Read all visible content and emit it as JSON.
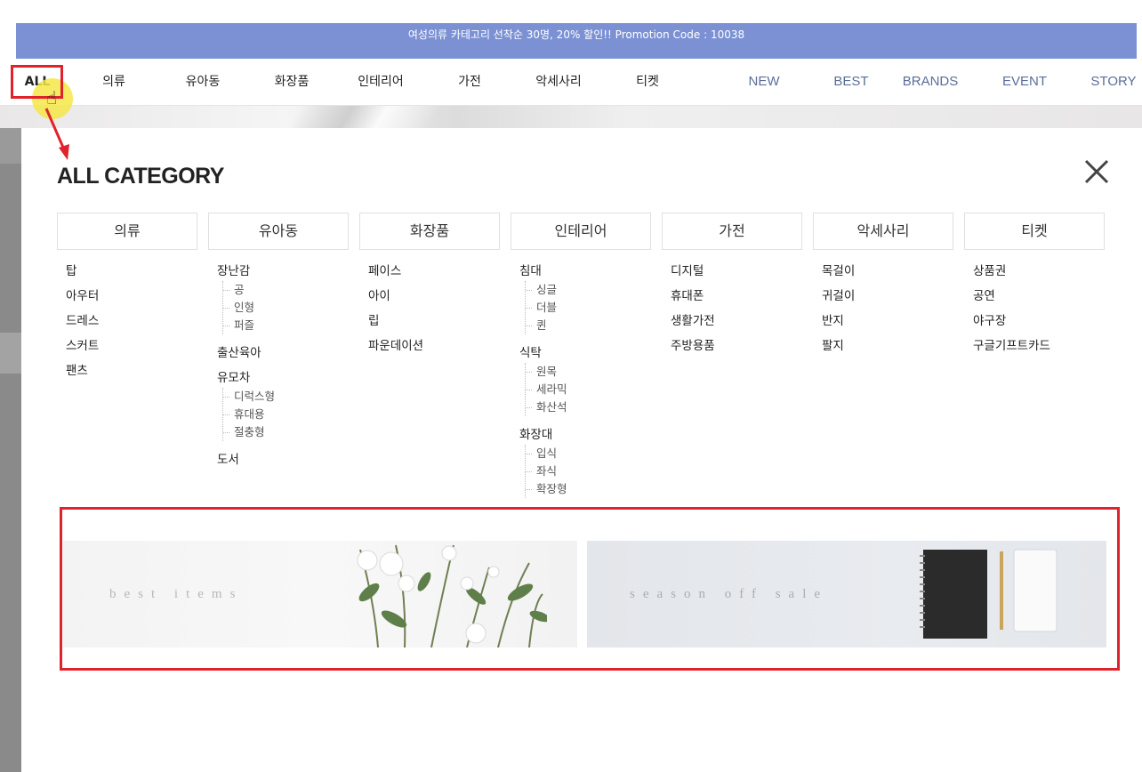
{
  "promo": {
    "text": "여성의류 카테고리 선착순 30명, 20% 할인!! Promotion Code : 10038"
  },
  "nav": {
    "all_label": "ALL",
    "items": [
      "의류",
      "유아동",
      "화장품",
      "인테리어",
      "가전",
      "악세사리",
      "티켓"
    ],
    "links": [
      "NEW",
      "BEST",
      "BRANDS",
      "EVENT",
      "STORY"
    ]
  },
  "panel": {
    "title": "ALL CATEGORY",
    "columns": [
      {
        "header": "의류",
        "categories": [
          {
            "name": "탑",
            "subs": []
          },
          {
            "name": "아우터",
            "subs": []
          },
          {
            "name": "드레스",
            "subs": []
          },
          {
            "name": "스커트",
            "subs": []
          },
          {
            "name": "팬츠",
            "subs": []
          }
        ]
      },
      {
        "header": "유아동",
        "categories": [
          {
            "name": "장난감",
            "subs": [
              "공",
              "인형",
              "퍼즐"
            ]
          },
          {
            "name": "출산육아",
            "subs": []
          },
          {
            "name": "유모차",
            "subs": [
              "디럭스형",
              "휴대용",
              "절충형"
            ]
          },
          {
            "name": "도서",
            "subs": []
          }
        ]
      },
      {
        "header": "화장품",
        "categories": [
          {
            "name": "페이스",
            "subs": []
          },
          {
            "name": "아이",
            "subs": []
          },
          {
            "name": "립",
            "subs": []
          },
          {
            "name": "파운데이션",
            "subs": []
          }
        ]
      },
      {
        "header": "인테리어",
        "categories": [
          {
            "name": "침대",
            "subs": [
              "싱글",
              "더블",
              "퀸"
            ]
          },
          {
            "name": "식탁",
            "subs": [
              "원목",
              "세라믹",
              "화산석"
            ]
          },
          {
            "name": "화장대",
            "subs": [
              "입식",
              "좌식",
              "확장형"
            ]
          }
        ]
      },
      {
        "header": "가전",
        "categories": [
          {
            "name": "디지털",
            "subs": []
          },
          {
            "name": "휴대폰",
            "subs": []
          },
          {
            "name": "생활가전",
            "subs": []
          },
          {
            "name": "주방용품",
            "subs": []
          }
        ]
      },
      {
        "header": "악세사리",
        "categories": [
          {
            "name": "목걸이",
            "subs": []
          },
          {
            "name": "귀걸이",
            "subs": []
          },
          {
            "name": "반지",
            "subs": []
          },
          {
            "name": "팔지",
            "subs": []
          }
        ]
      },
      {
        "header": "티켓",
        "categories": [
          {
            "name": "상품권",
            "subs": []
          },
          {
            "name": "공연",
            "subs": []
          },
          {
            "name": "야구장",
            "subs": []
          },
          {
            "name": "구글기프트카드",
            "subs": []
          }
        ]
      }
    ],
    "banners": [
      {
        "text": "best items"
      },
      {
        "text": "season off sale"
      }
    ]
  },
  "icons": {
    "close": "close-icon",
    "cursor": "hand-cursor-icon"
  },
  "colors": {
    "promo_bg": "#7b91d3",
    "accent_red": "#e0232b",
    "nav_link": "#5b6e9a"
  }
}
